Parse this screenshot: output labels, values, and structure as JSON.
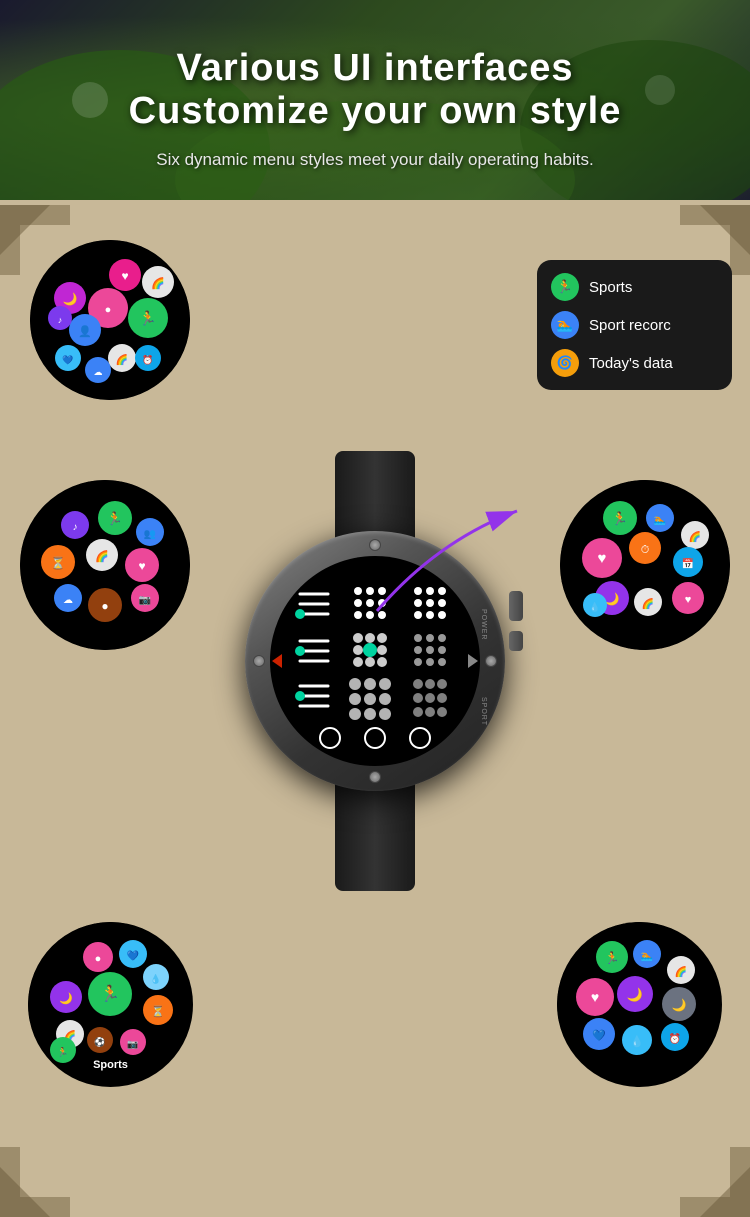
{
  "header": {
    "title_line1": "Various UI interfaces",
    "title_line2": "Customize your own style",
    "subtitle": "Six dynamic menu styles meet your daily operating habits."
  },
  "list_ui": {
    "items": [
      {
        "label": "Sports",
        "icon": "🏃",
        "color": "#22c55e"
      },
      {
        "label": "Sport recorc",
        "icon": "🏊",
        "color": "#3b82f6"
      },
      {
        "label": "Today's data",
        "icon": "🌀",
        "color": "#f59e0b"
      }
    ]
  },
  "circles": {
    "sports_label": "Sports"
  },
  "colors": {
    "background_panel": "#c8b898",
    "watch_bg": "#000000",
    "accent_green": "#00d4a0"
  }
}
